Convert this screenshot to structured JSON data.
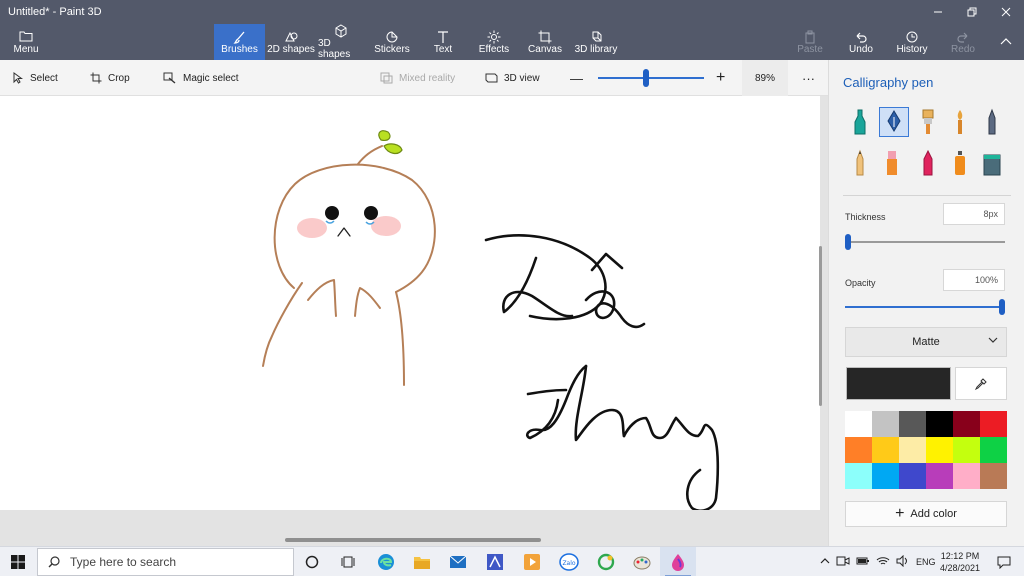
{
  "window": {
    "title": "Untitled* - Paint 3D"
  },
  "ribbon": {
    "menu_label": "Menu",
    "tools": [
      {
        "id": "brushes",
        "label": "Brushes",
        "icon": "brush-icon"
      },
      {
        "id": "shapes2d",
        "label": "2D shapes",
        "icon": "2d-shapes-icon"
      },
      {
        "id": "shapes3d",
        "label": "3D shapes",
        "icon": "3d-shapes-icon"
      },
      {
        "id": "stickers",
        "label": "Stickers",
        "icon": "stickers-icon"
      },
      {
        "id": "text",
        "label": "Text",
        "icon": "text-icon"
      },
      {
        "id": "effects",
        "label": "Effects",
        "icon": "effects-icon"
      },
      {
        "id": "canvas",
        "label": "Canvas",
        "icon": "canvas-icon"
      },
      {
        "id": "library3d",
        "label": "3D library",
        "icon": "3d-library-icon"
      }
    ],
    "paste_label": "Paste",
    "undo_label": "Undo",
    "history_label": "History",
    "redo_label": "Redo"
  },
  "subtoolbar": {
    "select_label": "Select",
    "crop_label": "Crop",
    "magic_select_label": "Magic select",
    "mixed_reality_label": "Mixed reality",
    "view3d_label": "3D view",
    "zoom_value": "89%",
    "zoom_level": 0.5
  },
  "panel": {
    "title": "Calligraphy pen",
    "brushes": [
      {
        "name": "marker-brush-icon",
        "active": false
      },
      {
        "name": "calligraphy-pen-icon",
        "active": true
      },
      {
        "name": "oil-brush-icon",
        "active": false
      },
      {
        "name": "watercolor-brush-icon",
        "active": false
      },
      {
        "name": "pixel-pen-icon",
        "active": false
      },
      {
        "name": "pencil-icon",
        "active": false
      },
      {
        "name": "eraser-icon",
        "active": false
      },
      {
        "name": "crayon-icon",
        "active": false
      },
      {
        "name": "spray-can-icon",
        "active": false
      },
      {
        "name": "fill-bucket-icon",
        "active": false
      }
    ],
    "thickness_label": "Thickness",
    "thickness_value": "8px",
    "thickness_level": 0.02,
    "opacity_label": "Opacity",
    "opacity_value": "100%",
    "opacity_level": 1.0,
    "finish_value": "Matte",
    "current_color": "#262626",
    "palette": [
      "#ffffff",
      "#c3c3c3",
      "#585858",
      "#000000",
      "#88001b",
      "#ec1c24",
      "#ff7f27",
      "#ffca18",
      "#fdeca6",
      "#fff200",
      "#c4ff0e",
      "#0ed145",
      "#8cfffb",
      "#00a8f3",
      "#3f48cc",
      "#b83dba",
      "#ffaec8",
      "#b97a56"
    ],
    "add_color_label": "Add color"
  },
  "colors": {
    "accent": "#3a70c9",
    "ribbon_bg": "#53596a",
    "drawing_stroke_brown": "#b57f57",
    "drawing_stroke_black": "#111111",
    "leaf_green": "#b9e021"
  },
  "taskbar": {
    "search_placeholder": "Type here to search",
    "language": "ENG",
    "time": "12:12 PM",
    "date": "4/28/2021"
  }
}
